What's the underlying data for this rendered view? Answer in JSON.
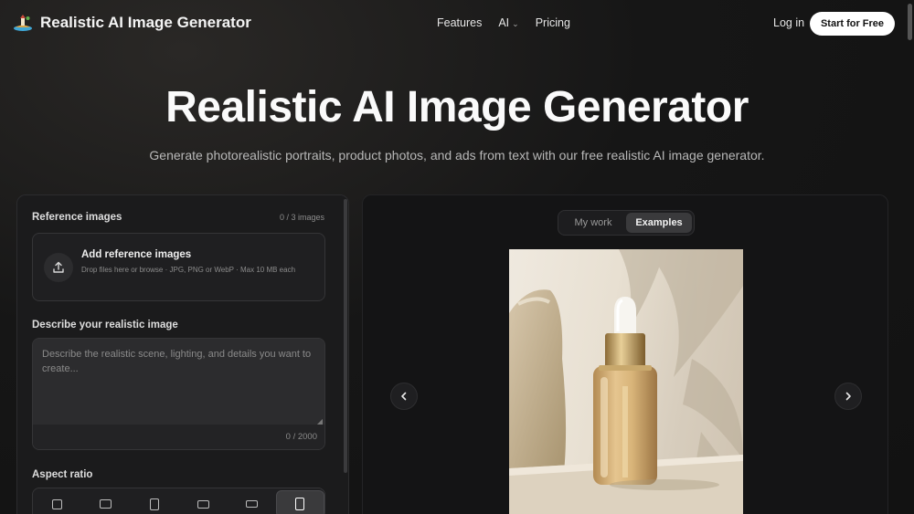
{
  "brand": {
    "name": "Realistic AI Image Generator"
  },
  "nav": {
    "links": [
      "Features",
      "AI",
      "Pricing"
    ],
    "login": "Log in",
    "cta": "Start for Free"
  },
  "hero": {
    "title": "Realistic AI Image Generator",
    "subtitle": "Generate photorealistic portraits, product photos, and ads from text with our free realistic AI image generator."
  },
  "reference": {
    "label": "Reference images",
    "count": "0 / 3 images",
    "upload_title": "Add reference images",
    "upload_help": "Drop files here or browse · JPG, PNG or WebP · Max 10 MB each",
    "icon": "upload-icon"
  },
  "prompt": {
    "label": "Describe your realistic image",
    "placeholder": "Describe the realistic scene, lighting, and details you want to create...",
    "value": "",
    "char_count": "0 / 2000"
  },
  "aspect": {
    "label": "Aspect ratio",
    "selected_index": 5,
    "option_count": 6
  },
  "preview": {
    "tabs": [
      "My work",
      "Examples"
    ],
    "active_tab": "Examples",
    "prev_icon": "chevron-left-icon",
    "next_icon": "chevron-right-icon",
    "image_subject": "serum dropper bottle on stone"
  }
}
